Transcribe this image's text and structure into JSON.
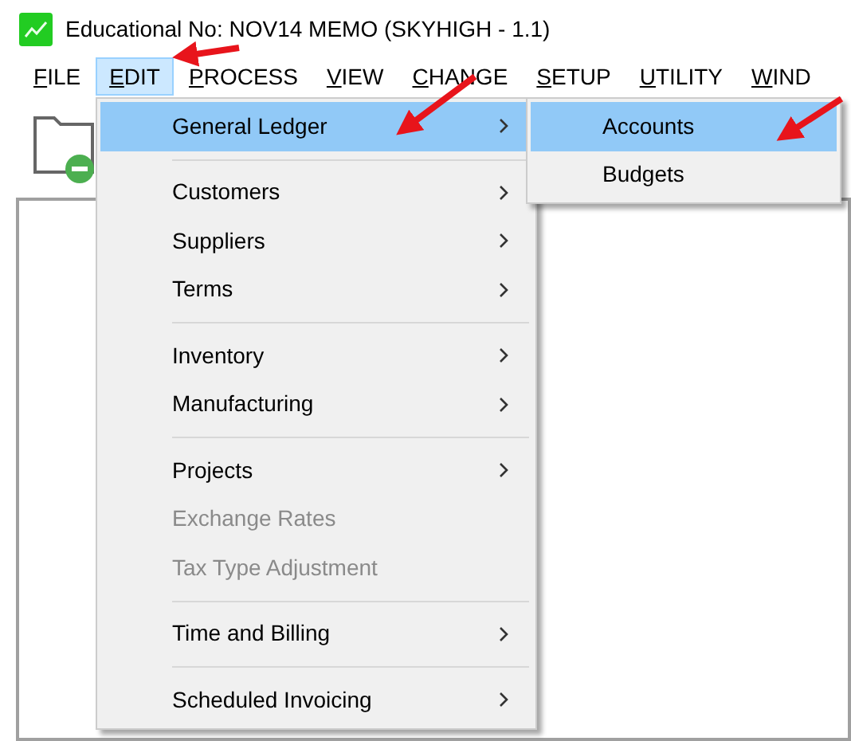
{
  "window": {
    "title": "Educational No: NOV14 MEMO (SKYHIGH - 1.1)"
  },
  "menu_bar": [
    {
      "label": "FILE",
      "selected": false
    },
    {
      "label": "EDIT",
      "selected": true
    },
    {
      "label": "PROCESS",
      "selected": false
    },
    {
      "label": "VIEW",
      "selected": false
    },
    {
      "label": "CHANGE",
      "selected": false
    },
    {
      "label": "SETUP",
      "selected": false
    },
    {
      "label": "UTILITY",
      "selected": false
    },
    {
      "label": "WIND",
      "selected": false
    }
  ],
  "edit_menu": {
    "groups": [
      [
        {
          "label": "General Ledger",
          "submenu": true,
          "disabled": false,
          "selected": true
        }
      ],
      [
        {
          "label": "Customers",
          "submenu": true,
          "disabled": false,
          "selected": false
        },
        {
          "label": "Suppliers",
          "submenu": true,
          "disabled": false,
          "selected": false
        },
        {
          "label": "Terms",
          "submenu": true,
          "disabled": false,
          "selected": false
        }
      ],
      [
        {
          "label": "Inventory",
          "submenu": true,
          "disabled": false,
          "selected": false
        },
        {
          "label": "Manufacturing",
          "submenu": true,
          "disabled": false,
          "selected": false
        }
      ],
      [
        {
          "label": "Projects",
          "submenu": true,
          "disabled": false,
          "selected": false
        },
        {
          "label": "Exchange Rates",
          "submenu": false,
          "disabled": true,
          "selected": false
        },
        {
          "label": "Tax Type Adjustment",
          "submenu": false,
          "disabled": true,
          "selected": false
        }
      ],
      [
        {
          "label": "Time and Billing",
          "submenu": true,
          "disabled": false,
          "selected": false
        }
      ],
      [
        {
          "label": "Scheduled Invoicing",
          "submenu": true,
          "disabled": false,
          "selected": false
        }
      ]
    ]
  },
  "general_ledger_submenu": [
    {
      "label": "Accounts",
      "selected": true
    },
    {
      "label": "Budgets",
      "selected": false
    }
  ]
}
